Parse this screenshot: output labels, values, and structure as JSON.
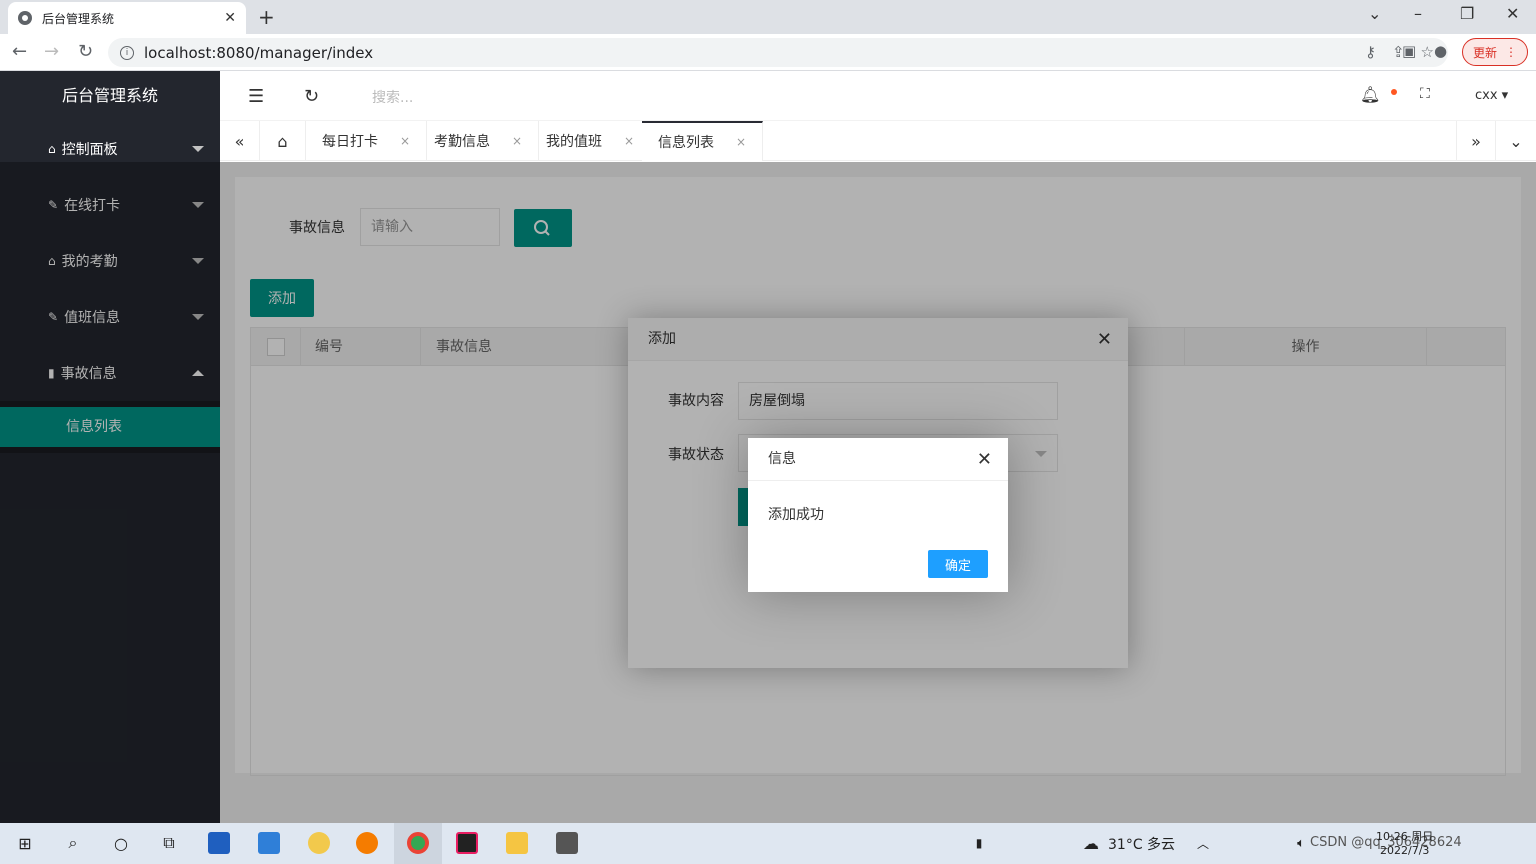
{
  "browser": {
    "tab_title": "后台管理系统",
    "tab_close": "✕",
    "new_tab": "+",
    "url": "localhost:8080/manager/index",
    "update_label": "更新"
  },
  "sidebar": {
    "logo": "后台管理系统",
    "items": [
      {
        "label": "控制面板",
        "icon": "home-icon"
      },
      {
        "label": "在线打卡",
        "icon": "pencil-icon"
      },
      {
        "label": "我的考勤",
        "icon": "home-icon"
      },
      {
        "label": "值班信息",
        "icon": "pencil-icon"
      },
      {
        "label": "事故信息",
        "icon": "book-icon"
      }
    ],
    "sub_items": [
      {
        "label": "信息列表"
      }
    ]
  },
  "header": {
    "search_placeholder": "搜索...",
    "user": "cxx"
  },
  "page_tabs": {
    "tabs": [
      {
        "label": "每日打卡"
      },
      {
        "label": "考勤信息"
      },
      {
        "label": "我的值班"
      },
      {
        "label": "信息列表"
      }
    ],
    "close": "×"
  },
  "main": {
    "search_label": "事故信息",
    "search_placeholder": "请输入",
    "add_button": "添加",
    "table_headers": [
      "编号",
      "事故信息",
      "操作"
    ]
  },
  "modal": {
    "title": "添加",
    "field1_label": "事故内容",
    "field1_value": "房屋倒塌",
    "field2_label": "事故状态"
  },
  "dialog": {
    "title": "信息",
    "message": "添加成功",
    "ok_label": "确定"
  },
  "taskbar": {
    "weather": "31°C 多云",
    "time": "10:26 周日",
    "date": "2022/7/3",
    "watermark": "CSDN @qq_306428624"
  },
  "colors": {
    "accent": "#009688",
    "sidebar_bg": "#23262e",
    "dialog_ok": "#1e9fff"
  }
}
